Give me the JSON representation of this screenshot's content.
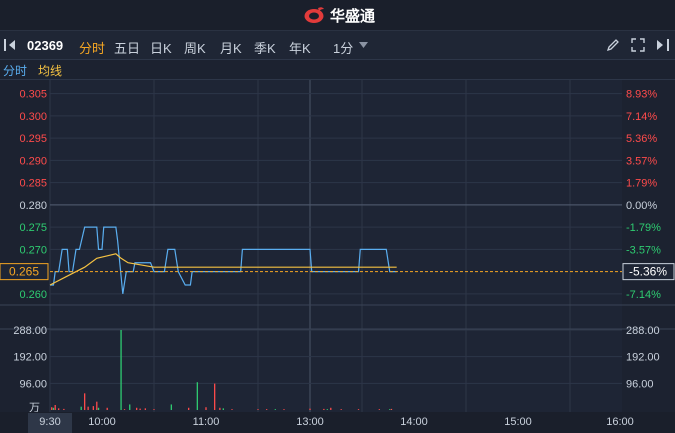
{
  "app": {
    "title": "华盛通"
  },
  "toolbar": {
    "code": "02369",
    "tabs": [
      "分时",
      "五日",
      "日K",
      "周K",
      "月K",
      "季K",
      "年K"
    ],
    "active_tab": "分时",
    "interval": "1分"
  },
  "legend": {
    "line1": "分时",
    "line2": "均线"
  },
  "colors": {
    "background": "#1c2230",
    "price_line": "#5aaef0",
    "avg_line": "#f5c242",
    "up": "#ff4b4b",
    "down": "#2ecc71",
    "neutral": "#c9d1dc",
    "active": "#f5a623"
  },
  "chart_data": {
    "type": "line",
    "reference_price": 0.28,
    "price_ticks": [
      {
        "price": 0.305,
        "label": "0.305",
        "pct": "8.93%"
      },
      {
        "price": 0.3,
        "label": "0.300",
        "pct": "7.14%"
      },
      {
        "price": 0.295,
        "label": "0.295",
        "pct": "5.36%"
      },
      {
        "price": 0.29,
        "label": "0.290",
        "pct": "3.57%"
      },
      {
        "price": 0.285,
        "label": "0.285",
        "pct": "1.79%"
      },
      {
        "price": 0.28,
        "label": "0.280",
        "pct": "0.00%"
      },
      {
        "price": 0.275,
        "label": "0.275",
        "pct": "-1.79%"
      },
      {
        "price": 0.27,
        "label": "0.270",
        "pct": "-3.57%"
      },
      {
        "price": 0.26,
        "label": "0.260",
        "pct": "-7.14%"
      }
    ],
    "current": {
      "price_label": "0.265",
      "pct_label": "-5.36%",
      "price": 0.265
    },
    "volume_ticks": [
      "288.00",
      "192.00",
      "96.00"
    ],
    "volume_unit": "万",
    "volume_max": 288,
    "time_labels": [
      "9:30",
      "10:00",
      "11:00",
      "13:00",
      "14:00",
      "15:00",
      "16:00"
    ],
    "price_series": [
      [
        0,
        0.262
      ],
      [
        2,
        0.262
      ],
      [
        3,
        0.265
      ],
      [
        5,
        0.265
      ],
      [
        7,
        0.27
      ],
      [
        10,
        0.27
      ],
      [
        11,
        0.265
      ],
      [
        13,
        0.265
      ],
      [
        15,
        0.27
      ],
      [
        17,
        0.27
      ],
      [
        20,
        0.275
      ],
      [
        27,
        0.275
      ],
      [
        28,
        0.27
      ],
      [
        30,
        0.27
      ],
      [
        31,
        0.275
      ],
      [
        38,
        0.275
      ],
      [
        39,
        0.272
      ],
      [
        42,
        0.26
      ],
      [
        44,
        0.265
      ],
      [
        48,
        0.265
      ],
      [
        49,
        0.267
      ],
      [
        58,
        0.267
      ],
      [
        60,
        0.265
      ],
      [
        66,
        0.265
      ],
      [
        68,
        0.27
      ],
      [
        72,
        0.27
      ],
      [
        74,
        0.265
      ],
      [
        78,
        0.262
      ],
      [
        81,
        0.262
      ],
      [
        82,
        0.265
      ],
      [
        88,
        0.265
      ],
      [
        89,
        0.265
      ],
      [
        110,
        0.265
      ],
      [
        111,
        0.27
      ],
      [
        150,
        0.27
      ],
      [
        151,
        0.265
      ],
      [
        178,
        0.265
      ],
      [
        179,
        0.27
      ],
      [
        194,
        0.27
      ],
      [
        196,
        0.265
      ],
      [
        200,
        0.265
      ]
    ],
    "avg_series": [
      [
        0,
        0.262
      ],
      [
        10,
        0.264
      ],
      [
        20,
        0.266
      ],
      [
        27,
        0.268
      ],
      [
        38,
        0.269
      ],
      [
        41,
        0.268
      ],
      [
        45,
        0.267
      ],
      [
        60,
        0.266
      ],
      [
        90,
        0.266
      ],
      [
        200,
        0.266
      ]
    ],
    "volume_up": [
      [
        1,
        10
      ],
      [
        3,
        18
      ],
      [
        5,
        6
      ],
      [
        8,
        4
      ],
      [
        20,
        60
      ],
      [
        22,
        12
      ],
      [
        25,
        14
      ],
      [
        27,
        30
      ],
      [
        33,
        8
      ],
      [
        43,
        3
      ],
      [
        50,
        8
      ],
      [
        52,
        5
      ],
      [
        55,
        6
      ],
      [
        60,
        3
      ],
      [
        80,
        8
      ],
      [
        90,
        10
      ],
      [
        95,
        95
      ],
      [
        98,
        8
      ],
      [
        105,
        3
      ],
      [
        120,
        3
      ],
      [
        125,
        3
      ],
      [
        135,
        3
      ],
      [
        150,
        5
      ],
      [
        158,
        4
      ],
      [
        162,
        8
      ],
      [
        168,
        3
      ],
      [
        178,
        3
      ],
      [
        190,
        3
      ],
      [
        197,
        4
      ]
    ],
    "volume_down": [
      [
        2,
        8
      ],
      [
        18,
        12
      ],
      [
        28,
        8
      ],
      [
        41,
        288
      ],
      [
        46,
        20
      ],
      [
        70,
        20
      ],
      [
        85,
        100
      ],
      [
        100,
        6
      ],
      [
        130,
        3
      ],
      [
        160,
        3
      ],
      [
        196,
        3
      ]
    ],
    "total_minutes": 330
  }
}
